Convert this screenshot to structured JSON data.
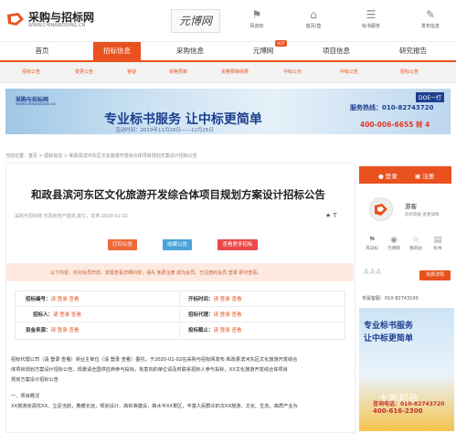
{
  "header": {
    "site_name": "采购与招标网",
    "site_domain": "WWW.CHINABIDDING.CN",
    "yuanbo_logo": "元博网",
    "icons": [
      {
        "label": "风向标",
        "icon": "flag-icon"
      },
      {
        "label": "首页/登",
        "icon": "home-icon"
      },
      {
        "label": "标书服务",
        "icon": "document-icon"
      },
      {
        "label": "发布信息",
        "icon": "edit-icon"
      }
    ]
  },
  "nav": {
    "items": [
      "首页",
      "招标信息",
      "采购信息",
      "元博网",
      "项目信息",
      "研究报告"
    ],
    "active": "招标信息",
    "hot_badge": "HOT"
  },
  "subnav": {
    "items": [
      "招标公告",
      "变更公告",
      "答疑",
      "资格预审",
      "资格预审结果",
      "中标公示",
      "中标公告",
      "招标公告"
    ]
  },
  "banner": {
    "logo": "采购与招标网",
    "logo_sub": "WWW.CHINABIDDING.CN",
    "headline": "专业标书服务 让中标更简单",
    "date": "活动时间：2019年11月26日——12月25日",
    "hotline_label": "服务热线：010-82743720",
    "tel": "400-006-6655 转 4",
    "tag": "DOE一打"
  },
  "breadcrumb": "当前位置：首页 > 招标信息 > 和政县滨河东区文化旅游开发综合体项目规划方案设计招标公告",
  "article": {
    "title": "和政县滨河东区文化旅游开发综合体项目规划方案设计招标公告",
    "meta": "采购与招标网   市政房地产建筑,其它，甘肃   2020-01-02",
    "meta_icons": "★  T",
    "buttons": [
      {
        "label": "打印公告",
        "color": "#ef6b3a"
      },
      {
        "label": "收藏公告",
        "color": "#4aa3d9"
      },
      {
        "label": "查看更多招标",
        "color": "#e84a4a"
      }
    ],
    "notice": "以下内容，仅对会员开放，如需查看详细内容，请先 免费注册 成为会员。已注册的会员 登录 即可查看。",
    "fields": [
      {
        "label": "招标编号：",
        "value": "请 登录 查看"
      },
      {
        "label": "开标时间：",
        "value": "请 登录 查看"
      },
      {
        "label": "招标人：",
        "value": "请 登录 查看"
      },
      {
        "label": "招标代理：",
        "value": "请 登录 查看"
      },
      {
        "label": "资金来源：",
        "value": "请 登录 查看"
      },
      {
        "label": "投标截止：",
        "value": "请 登录 查看"
      }
    ],
    "paragraphs": [
      "招标代理公司（请 登录 查看）受业主单位（请 登录 查看）委托，于2020-01-02在采购与招标网发布 和政县滨河东区文化旅游开发综合",
      "体项目规划方案设计招标公告，现邀请全国供应商参与投标，有意向的单位请及时联系招标人参与投标。XX文化旅游开发综合体项目",
      "规划方案设计招标公告",
      "一、项目概况",
      "XX旅游资源优XX、立足当前，着眼长远，规划设计、高标准建设，高水平XX景区，丰富人民群众的文XX旅游、文化、生态、高质产业为"
    ]
  },
  "sidebar": {
    "login": "登录",
    "register": "注册",
    "guest": "游客",
    "guest_sub": "您的等级  查看详情",
    "icons": [
      {
        "label": "风向标",
        "icon": "flag-icon"
      },
      {
        "label": "元博网",
        "icon": "eye-icon"
      },
      {
        "label": "我的站",
        "icon": "star-icon"
      },
      {
        "label": "标书",
        "icon": "file-icon"
      }
    ],
    "aaa": "AAA",
    "service_btn": "资费详情",
    "hotline": "专属客服：010-82743190",
    "ad_line1": "专业标书服务",
    "ad_line2": "让中标更简单",
    "ad_tel1": "咨询电话：010-82743720",
    "ad_tel2": "400-616-2300",
    "watermark": "大美和政"
  },
  "colors": {
    "accent": "#e9511f",
    "banner_blue": "#1d3f8f"
  }
}
